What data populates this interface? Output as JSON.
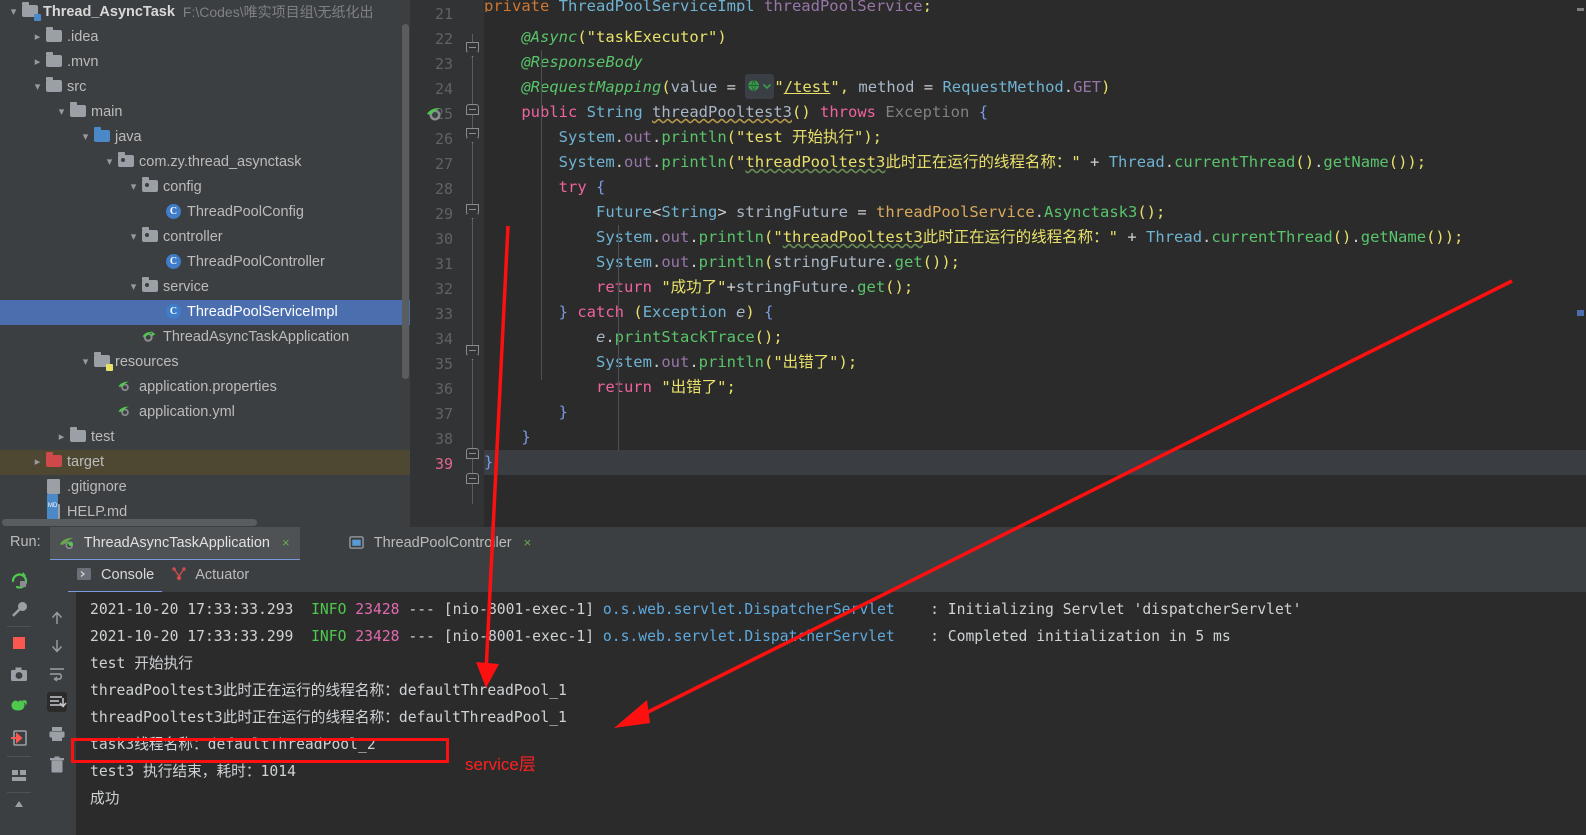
{
  "project": {
    "root": {
      "label": "Thread_AsyncTask",
      "path": "F:\\Codes\\唯实项目组\\无纸化出"
    },
    "items": [
      {
        "label": ".idea",
        "icon": "folder-icon",
        "indent": 1,
        "chev": "right"
      },
      {
        "label": ".mvn",
        "icon": "folder-icon",
        "indent": 1,
        "chev": "right"
      },
      {
        "label": "src",
        "icon": "folder-icon",
        "indent": 1,
        "chev": "down"
      },
      {
        "label": "main",
        "icon": "folder-icon",
        "indent": 2,
        "chev": "down"
      },
      {
        "label": "java",
        "icon": "folder-source-icon",
        "indent": 3,
        "chev": "down"
      },
      {
        "label": "com.zy.thread_asynctask",
        "icon": "package-icon",
        "indent": 4,
        "chev": "down"
      },
      {
        "label": "config",
        "icon": "package-icon",
        "indent": 5,
        "chev": "down"
      },
      {
        "label": "ThreadPoolConfig",
        "icon": "java-class-icon",
        "indent": 6,
        "chev": "none"
      },
      {
        "label": "controller",
        "icon": "package-icon",
        "indent": 5,
        "chev": "down"
      },
      {
        "label": "ThreadPoolController",
        "icon": "java-class-icon",
        "indent": 6,
        "chev": "none"
      },
      {
        "label": "service",
        "icon": "package-icon",
        "indent": 5,
        "chev": "down"
      },
      {
        "label": "ThreadPoolServiceImpl",
        "icon": "java-class-icon",
        "indent": 6,
        "chev": "none",
        "selected": true
      },
      {
        "label": "ThreadAsyncTaskApplication",
        "icon": "spring-boot-icon",
        "indent": 5,
        "chev": "none"
      },
      {
        "label": "resources",
        "icon": "folder-resources-icon",
        "indent": 3,
        "chev": "down"
      },
      {
        "label": "application.properties",
        "icon": "spring-file-icon",
        "indent": 4,
        "chev": "none"
      },
      {
        "label": "application.yml",
        "icon": "spring-file-icon",
        "indent": 4,
        "chev": "none"
      },
      {
        "label": "test",
        "icon": "folder-icon",
        "indent": 2,
        "chev": "right"
      },
      {
        "label": "target",
        "icon": "folder-excluded-icon",
        "indent": 1,
        "chev": "right",
        "highlight": true
      },
      {
        "label": ".gitignore",
        "icon": "gitignore-icon",
        "indent": 1,
        "chev": "none"
      },
      {
        "label": "HELP.md",
        "icon": "markdown-icon",
        "indent": 1,
        "chev": "none"
      }
    ]
  },
  "editor": {
    "first_line_number": 21,
    "current_line_number": 39,
    "line_numbers": [
      21,
      22,
      23,
      24,
      25,
      26,
      27,
      28,
      29,
      30,
      31,
      32,
      33,
      34,
      35,
      36,
      37,
      38,
      39
    ],
    "url_chip": "/test",
    "lines": [
      {
        "n": 21,
        "text": "private ThreadPoolServiceImpl threadPoolService;",
        "cut": true
      },
      {
        "n": 22,
        "text": "@Async(\"taskExecutor\")"
      },
      {
        "n": 23,
        "text": "@ResponseBody"
      },
      {
        "n": 24,
        "text": "@RequestMapping(value = \"/test\", method = RequestMethod.GET)"
      },
      {
        "n": 25,
        "text": "public String threadPooltest3() throws Exception {"
      },
      {
        "n": 26,
        "text": "System.out.println(\"test 开始执行\");"
      },
      {
        "n": 27,
        "text": "System.out.println(\"threadPooltest3此时正在运行的线程名称：\" + Thread.currentThread().getName());"
      },
      {
        "n": 28,
        "text": "try {"
      },
      {
        "n": 29,
        "text": "Future<String> stringFuture = threadPoolService.Asynctask3();"
      },
      {
        "n": 30,
        "text": "System.out.println(\"threadPooltest3此时正在运行的线程名称：\" + Thread.currentThread().getName());"
      },
      {
        "n": 31,
        "text": "System.out.println(stringFuture.get());"
      },
      {
        "n": 32,
        "text": "return \"成功了\"+stringFuture.get();"
      },
      {
        "n": 33,
        "text": "} catch (Exception e) {"
      },
      {
        "n": 34,
        "text": "e.printStackTrace();"
      },
      {
        "n": 35,
        "text": "System.out.println(\"出错了\");"
      },
      {
        "n": 36,
        "text": "return \"出错了\";"
      },
      {
        "n": 37,
        "text": "}"
      },
      {
        "n": 38,
        "text": "}"
      },
      {
        "n": 39,
        "text": "}"
      }
    ]
  },
  "run_window": {
    "label": "Run:",
    "tabs": [
      {
        "label": "ThreadAsyncTaskApplication",
        "icon": "spring-boot-icon",
        "active": true,
        "close": "×"
      },
      {
        "label": "ThreadPoolController",
        "icon": "window-icon",
        "active": false,
        "close": "×"
      }
    ],
    "console_tabs": [
      {
        "label": "Console",
        "icon": "console-icon",
        "active": true
      },
      {
        "label": "Actuator",
        "icon": "actuator-icon",
        "active": false
      }
    ],
    "left_toolbar": [
      {
        "name": "rerun-icon"
      },
      {
        "name": "wrench-settings-icon"
      },
      {
        "name": "stop-icon"
      },
      {
        "name": "camera-icon"
      },
      {
        "name": "debug-frog-icon"
      },
      {
        "name": "open-in-icon"
      },
      {
        "name": "layout-icon"
      },
      {
        "name": "pin-icon"
      }
    ],
    "console_toolbar": [
      {
        "name": "scroll-up-icon"
      },
      {
        "name": "scroll-down-icon"
      },
      {
        "name": "soft-wrap-icon"
      },
      {
        "name": "scroll-to-end-icon"
      },
      {
        "name": "print-icon"
      },
      {
        "name": "trash-icon"
      }
    ],
    "console_lines": [
      {
        "type": "log",
        "timestamp": "2021-10-20 17:33:33.293",
        "level": "INFO",
        "pid": "23428",
        "sep": "---",
        "thread": "[nio-8001-exec-1]",
        "logger": "o.s.web.servlet.DispatcherServlet",
        "message": ": Initializing Servlet 'dispatcherServlet'"
      },
      {
        "type": "log",
        "timestamp": "2021-10-20 17:33:33.299",
        "level": "INFO",
        "pid": "23428",
        "sep": "---",
        "thread": "[nio-8001-exec-1]",
        "logger": "o.s.web.servlet.DispatcherServlet",
        "message": ": Completed initialization in 5 ms"
      },
      {
        "type": "plain",
        "text": "test 开始执行"
      },
      {
        "type": "plain",
        "text": "threadPooltest3此时正在运行的线程名称：defaultThreadPool_1"
      },
      {
        "type": "plain",
        "text": "threadPooltest3此时正在运行的线程名称：defaultThreadPool_1"
      },
      {
        "type": "plain",
        "text": "task3线程名称：defaultThreadPool_2",
        "boxed": true
      },
      {
        "type": "plain",
        "text": "test3 执行结束，耗时：1014"
      },
      {
        "type": "plain",
        "text": "成功"
      }
    ]
  },
  "annotations": {
    "service_label": "service层",
    "accent_color": "#ff1010",
    "arrows": 2
  }
}
